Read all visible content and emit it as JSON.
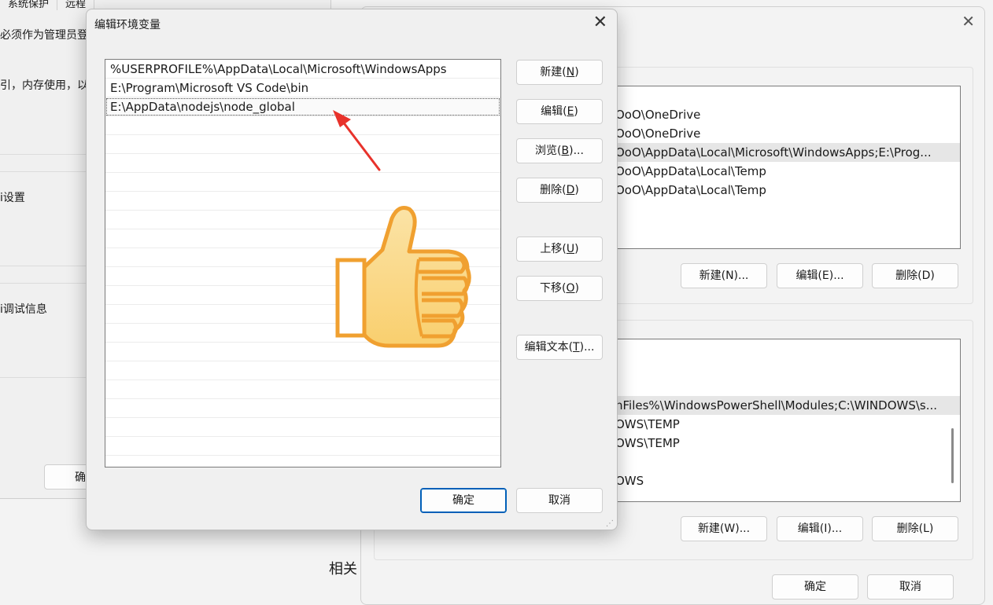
{
  "background_left": {
    "tabs": [
      "系统保护",
      "远程"
    ],
    "line1": "必须作为管理员登",
    "line2": "引，内存使用，以",
    "line3": "i设置",
    "line4": "i调试信息",
    "ok_label": "确"
  },
  "env_window": {
    "user_vars": [
      "",
      "OoO\\OneDrive",
      "OoO\\OneDrive",
      "OoO\\AppData\\Local\\Microsoft\\WindowsApps;E:\\Prog...",
      "OoO\\AppData\\Local\\Temp",
      "OoO\\AppData\\Local\\Temp"
    ],
    "user_buttons": [
      "新建(N)...",
      "编辑(E)...",
      "删除(D)"
    ],
    "system_vars": [
      "",
      "",
      "",
      "nFiles%\\WindowsPowerShell\\Modules;C:\\WINDOWS\\s...",
      "OWS\\TEMP",
      "OWS\\TEMP",
      "",
      "OWS"
    ],
    "system_buttons": [
      "新建(W)...",
      "编辑(I)...",
      "删除(L)"
    ],
    "related": "相关",
    "footer_buttons": [
      "确定",
      "取消"
    ]
  },
  "dialog": {
    "title": "编辑环境变量",
    "paths": [
      "%USERPROFILE%\\AppData\\Local\\Microsoft\\WindowsApps",
      "E:\\Program\\Microsoft VS Code\\bin",
      "E:\\AppData\\nodejs\\node_global"
    ],
    "empty_rows": 18,
    "buttons": {
      "new": {
        "text": "新建(",
        "acc": "N",
        "end": ")"
      },
      "edit": {
        "text": "编辑(",
        "acc": "E",
        "end": ")"
      },
      "browse": {
        "text": "浏览(",
        "acc": "B",
        "end": ")..."
      },
      "delete": {
        "text": "删除(",
        "acc": "D",
        "end": ")"
      },
      "up": {
        "text": "上移(",
        "acc": "U",
        "end": ")"
      },
      "down": {
        "text": "下移(",
        "acc": "O",
        "end": ")"
      },
      "edit_text": {
        "text": "编辑文本(",
        "acc": "T",
        "end": ")..."
      }
    },
    "ok": "确定",
    "cancel": "取消"
  },
  "annotation": {
    "arrow_color": "#e8322b",
    "thumb_fill": "#fbd88a",
    "thumb_stroke": "#f0a030",
    "icons": [
      "red-arrow-annotation-icon",
      "thumbs-up-icon"
    ]
  }
}
